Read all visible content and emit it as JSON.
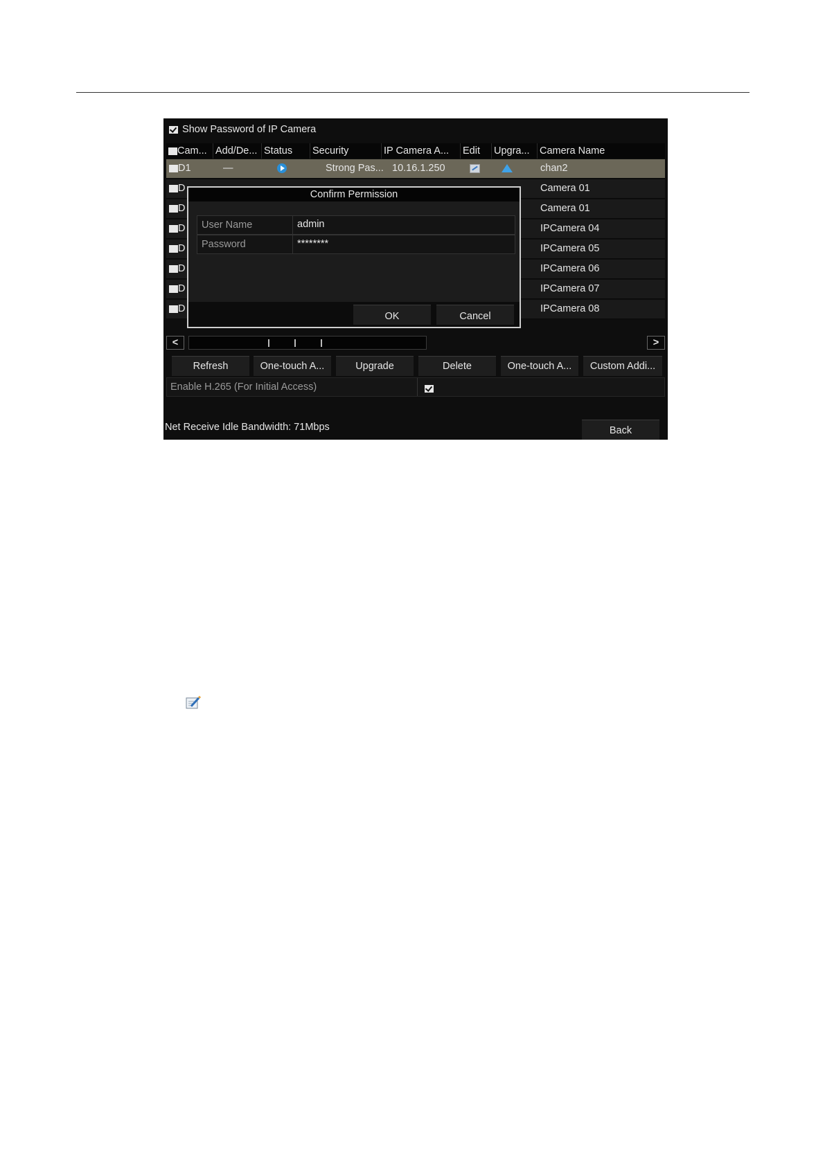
{
  "show_password": {
    "label": "Show Password of IP Camera",
    "checked": true
  },
  "table": {
    "columns": [
      "Cam...",
      "Add/De...",
      "Status",
      "Security",
      "IP Camera A...",
      "Edit",
      "Upgra...",
      "Camera Name"
    ],
    "rows": [
      {
        "camera_no": "D1",
        "add_delete": "—",
        "security": "Strong Pas...",
        "ip": "10.16.1.250",
        "name": "chan2"
      },
      {
        "camera_no": "D",
        "name": "Camera 01"
      },
      {
        "camera_no": "D",
        "name": "Camera 01"
      },
      {
        "camera_no": "D",
        "name": "IPCamera 04"
      },
      {
        "camera_no": "D",
        "name": "IPCamera 05"
      },
      {
        "camera_no": "D",
        "name": "IPCamera 06"
      },
      {
        "camera_no": "D",
        "name": "IPCamera 07"
      },
      {
        "camera_no": "D",
        "name": "IPCamera 08"
      }
    ]
  },
  "dialog": {
    "title": "Confirm Permission",
    "username_label": "User Name",
    "username_value": "admin",
    "password_label": "Password",
    "password_value": "********",
    "ok": "OK",
    "cancel": "Cancel"
  },
  "scrollbar": {
    "left": "<",
    "right": ">"
  },
  "buttons": [
    "Refresh",
    "One-touch A...",
    "Upgrade",
    "Delete",
    "One-touch A...",
    "Custom Addi..."
  ],
  "h265": {
    "label": "Enable H.265 (For Initial Access)",
    "checked": true
  },
  "status_text": "Net Receive Idle Bandwidth: 71Mbps",
  "back": "Back",
  "icons": {
    "status": "play-icon",
    "edit": "edit-icon",
    "upgrade": "upgrade-icon"
  }
}
